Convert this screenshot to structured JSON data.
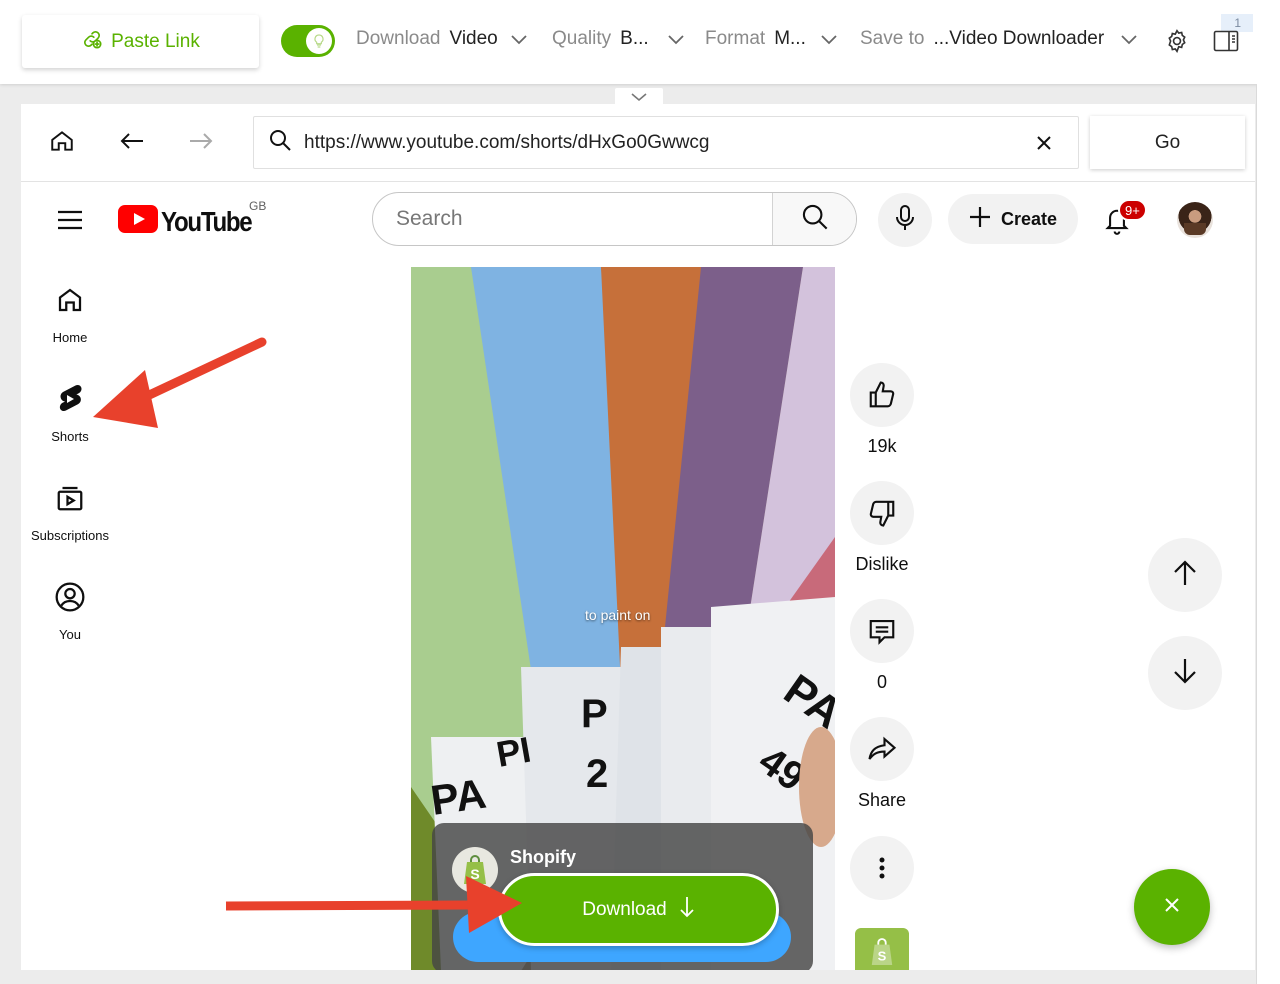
{
  "toolbar": {
    "paste_link_label": "Paste Link",
    "download_label": "Download",
    "download_value": "Video",
    "quality_label": "Quality",
    "quality_value": "B...",
    "format_label": "Format",
    "format_value": "M...",
    "save_label": "Save to",
    "save_value": "...Video Downloader",
    "notification_count": "1",
    "toggle_on": true
  },
  "browser": {
    "url": "https://www.youtube.com/shorts/dHxGo0Gwwcg",
    "go_label": "Go"
  },
  "youtube": {
    "logo_text": "YouTube",
    "region": "GB",
    "search_placeholder": "Search",
    "create_label": "Create",
    "notification_badge": "9+",
    "sidebar": [
      {
        "label": "Home",
        "icon": "home-icon"
      },
      {
        "label": "Shorts",
        "icon": "shorts-icon"
      },
      {
        "label": "Subscriptions",
        "icon": "subscriptions-icon"
      },
      {
        "label": "You",
        "icon": "account-icon"
      }
    ]
  },
  "short": {
    "caption": "to paint on",
    "advertiser": "Shopify",
    "download_button_label": "Download",
    "actions": {
      "likes": "19k",
      "dislike_label": "Dislike",
      "comments": "0",
      "share_label": "Share"
    }
  },
  "colors": {
    "accent_green": "#5ab200",
    "youtube_red": "#ff0000",
    "annotation_red": "#e8412c",
    "ad_blue": "#3ea6ff"
  }
}
